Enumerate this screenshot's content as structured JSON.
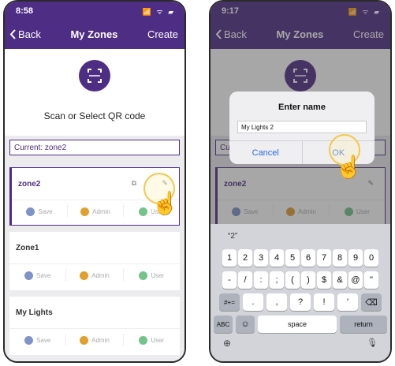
{
  "left": {
    "status": {
      "time": "8:58",
      "icons": "📶 ᯤ ▰"
    },
    "nav": {
      "back": "Back",
      "title": "My Zones",
      "action": "Create"
    },
    "qr": {
      "text": "Scan or Select QR code"
    },
    "current": "Current:  zone2",
    "zones": [
      {
        "name": "zone2",
        "actions": [
          "Save",
          "Admin",
          "User"
        ]
      },
      {
        "name": "Zone1",
        "actions": [
          "Save",
          "Admin",
          "User"
        ]
      },
      {
        "name": "My Lights",
        "actions": [
          "Save",
          "Admin",
          "User"
        ]
      }
    ]
  },
  "right": {
    "status": {
      "time": "9:17",
      "icons": "📶 ᯤ ▰"
    },
    "nav": {
      "back": "Back",
      "title": "My Zones",
      "action": "Create"
    },
    "current_short": "Curr",
    "zone_name": "zone2",
    "zone_actions": [
      "Save",
      "Admin",
      "User"
    ],
    "dialog": {
      "title": "Enter name",
      "value": "My Lights 2",
      "cancel": "Cancel",
      "ok": "OK"
    },
    "keyboard": {
      "suggestion": "“2”",
      "row1": [
        "1",
        "2",
        "3",
        "4",
        "5",
        "6",
        "7",
        "8",
        "9",
        "0"
      ],
      "row2": [
        "-",
        "/",
        ":",
        ";",
        "(",
        ")",
        "$",
        "&",
        "@",
        "\""
      ],
      "row3": [
        "#+=",
        ".",
        ",",
        "?",
        "!",
        "'",
        "⌫"
      ],
      "row4": [
        "ABC",
        "☺",
        "space",
        "return"
      ],
      "row5": [
        "⊕",
        "🎙"
      ]
    }
  }
}
